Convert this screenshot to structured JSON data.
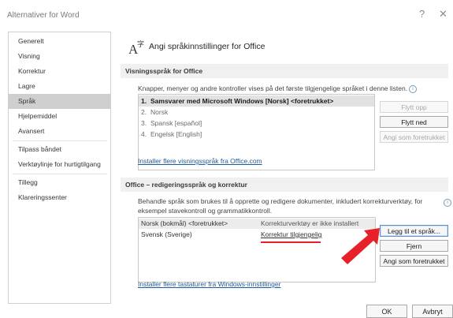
{
  "window": {
    "title": "Alternativer for Word",
    "help_icon": "?",
    "close_icon": "✕"
  },
  "sidebar": {
    "items": [
      {
        "label": "Generelt"
      },
      {
        "label": "Visning"
      },
      {
        "label": "Korrektur"
      },
      {
        "label": "Lagre"
      },
      {
        "label": "Språk",
        "selected": true
      },
      {
        "label": "Hjelpemiddel"
      },
      {
        "label": "Avansert"
      },
      {
        "label": "Tilpass båndet"
      },
      {
        "label": "Verktøylinje for hurtigtilgang"
      },
      {
        "label": "Tillegg"
      },
      {
        "label": "Klareringssenter"
      }
    ]
  },
  "header": {
    "title": "Angi språkinnstillinger for Office"
  },
  "display_section": {
    "title": "Visningsspråk for Office",
    "description": "Knapper, menyer og andre kontroller vises på det første tilgjengelige språket i denne listen.",
    "languages": [
      {
        "num": "1.",
        "label": "Samsvarer med Microsoft Windows [Norsk] <foretrukket>"
      },
      {
        "num": "2.",
        "label": "Norsk"
      },
      {
        "num": "3.",
        "label": "Spansk [español]"
      },
      {
        "num": "4.",
        "label": "Engelsk [English]"
      }
    ],
    "buttons": {
      "move_up": "Flytt opp",
      "move_down": "Flytt ned",
      "set_preferred": "Angi som foretrukket"
    },
    "install_link": "Installer flere visningsspråk fra Office.com"
  },
  "editing_section": {
    "title": "Office – redigeringsspråk og korrektur",
    "description_line1": "Behandle språk som brukes til å opprette og redigere dokumenter, inkludert korrekturverktøy, for",
    "description_line2": "eksempel stavekontroll og grammatikkontroll.",
    "languages": [
      {
        "name": "Norsk (bokmål) <foretrukket>",
        "status": "Korrekturverktøy er ikke installert"
      },
      {
        "name": "Svensk (Sverige)",
        "status": "Korrektur tilgjengelig"
      }
    ],
    "buttons": {
      "add_language": "Legg til et språk...",
      "remove": "Fjern",
      "set_preferred": "Angi som foretrukket"
    },
    "install_link": "Installer flere tastaturer fra Windows-innstillinger"
  },
  "footer": {
    "ok": "OK",
    "cancel": "Avbryt"
  },
  "colors": {
    "annotation_red": "#e8202a",
    "link_blue": "#1f5b9c",
    "selected_nav": "#cfcfcf"
  }
}
